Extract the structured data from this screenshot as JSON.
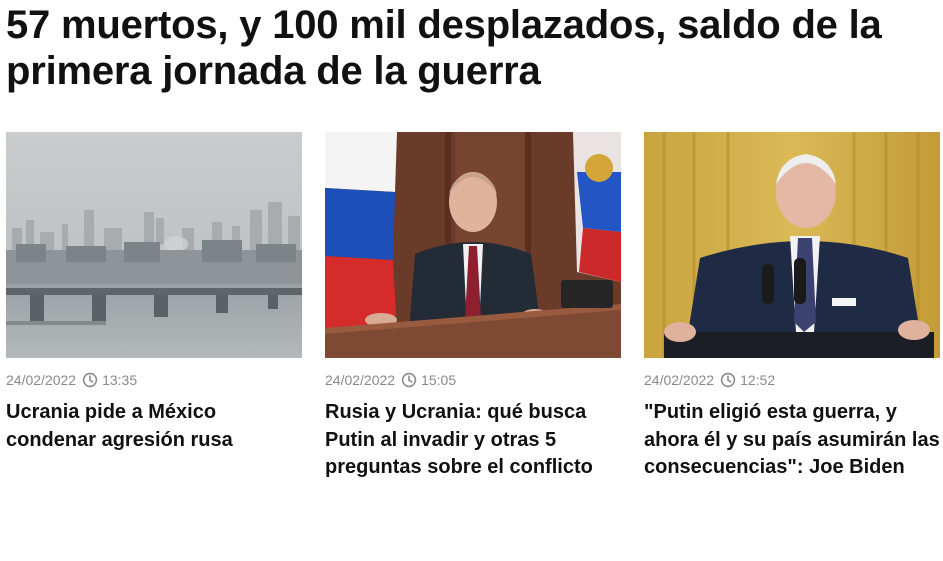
{
  "headline": "57 muertos, y 100 mil desplazados, saldo de la primera jornada de la guerra",
  "articles": [
    {
      "date": "24/02/2022",
      "time": "13:35",
      "icon": "clock-icon",
      "title": "Ucrania pide a México condenar agresión rusa"
    },
    {
      "date": "24/02/2022",
      "time": "15:05",
      "icon": "clock-icon",
      "title": "Rusia y Ucrania: qué busca Putin al invadir y otras 5 preguntas sobre el conflicto"
    },
    {
      "date": "24/02/2022",
      "time": "12:52",
      "icon": "clock-icon",
      "title": "\"Putin eligió esta guerra, y ahora él y su país asumirán las consecuencias\": Joe Biden"
    }
  ],
  "colors": {
    "text": "#111111",
    "meta": "#8a8a8a",
    "background": "#ffffff"
  }
}
